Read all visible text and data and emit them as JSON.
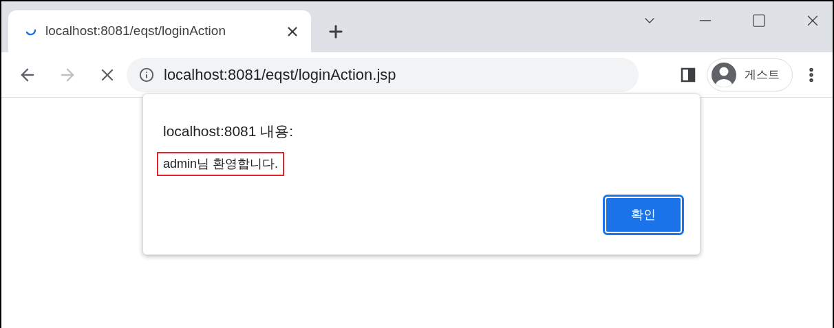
{
  "tab": {
    "title": "localhost:8081/eqst/loginAction",
    "loading": true,
    "selected": true
  },
  "address_bar": {
    "url": "localhost:8081/eqst/loginAction.jsp"
  },
  "nav": {
    "back_disabled": false,
    "forward_disabled": true
  },
  "profile": {
    "label": "게스트"
  },
  "dialog": {
    "title": "localhost:8081 내용:",
    "message": "admin님 환영합니다.",
    "message_highlighted": true,
    "buttons": [
      {
        "label": "확인",
        "focused": true
      }
    ]
  }
}
